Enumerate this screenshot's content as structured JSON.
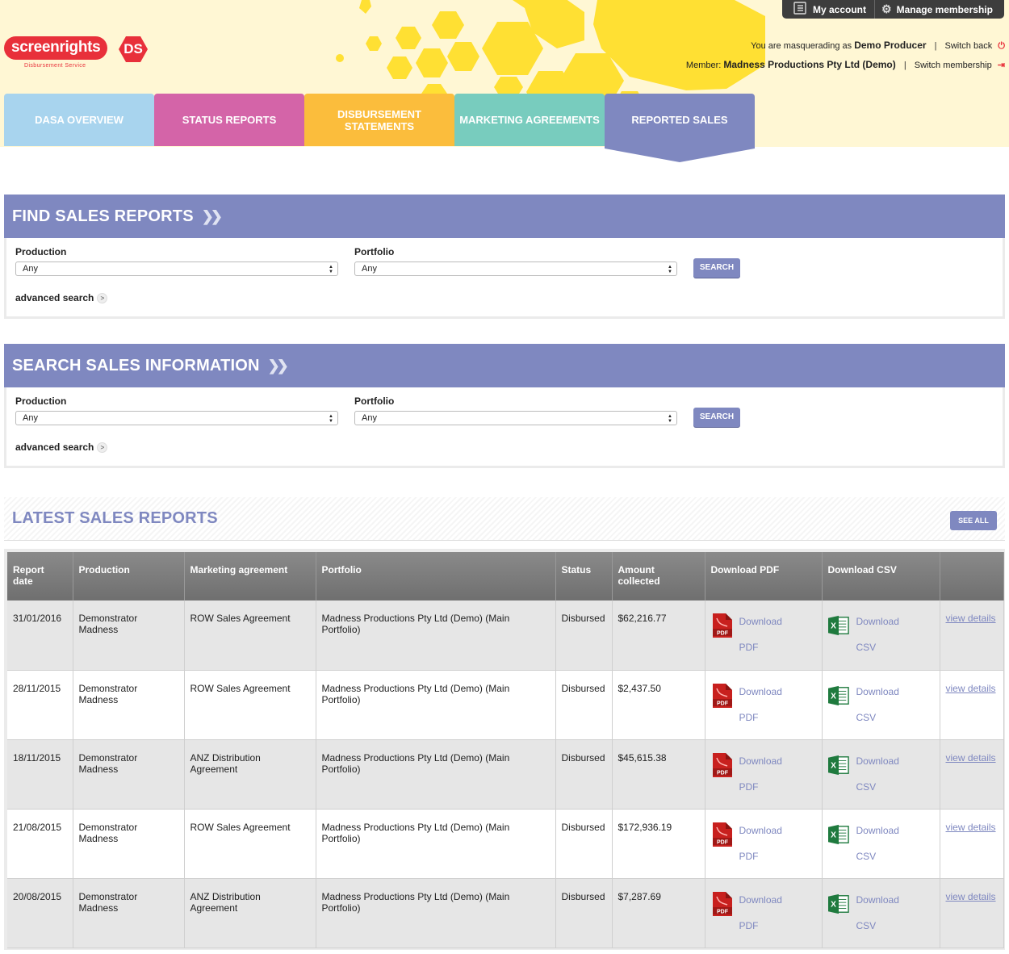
{
  "brand": {
    "name": "screenrights",
    "badge": "DS",
    "sub": "Disbursement Service",
    "red": "#e8303a"
  },
  "topbar": {
    "account_label": "My account",
    "account_icon": "account-icon",
    "membership_label": "Manage membership",
    "membership_icon": "gear-icon"
  },
  "masquerade": {
    "prefix": "You are masquerading as",
    "name": "Demo Producer",
    "switch_back": "Switch back"
  },
  "member": {
    "prefix": "Member:",
    "name": "Madness Productions Pty Ltd (Demo)",
    "switch": "Switch membership"
  },
  "tabs": [
    {
      "label": "DASA OVERVIEW",
      "color": "#a8d4ee"
    },
    {
      "label": "STATUS REPORTS",
      "color": "#d464a8"
    },
    {
      "label": "DISBURSEMENT STATEMENTS",
      "color": "#fbbd3c"
    },
    {
      "label": "MARKETING AGREEMENTS",
      "color": "#78ccbe"
    },
    {
      "label": "REPORTED SALES",
      "color": "#7f88c0",
      "active": true
    }
  ],
  "find": {
    "title": "FIND SALES REPORTS",
    "production_label": "Production",
    "production_value": "Any",
    "portfolio_label": "Portfolio",
    "portfolio_value": "Any",
    "search": "SEARCH",
    "advanced": "advanced search"
  },
  "searchinfo": {
    "title": "SEARCH SALES INFORMATION",
    "production_label": "Production",
    "production_value": "Any",
    "portfolio_label": "Portfolio",
    "portfolio_value": "Any",
    "search": "SEARCH",
    "advanced": "advanced search"
  },
  "latest": {
    "title": "LATEST SALES REPORTS",
    "see_all": "SEE ALL",
    "columns": [
      "Report date",
      "Production",
      "Marketing agreement",
      "Portfolio",
      "Status",
      "Amount collected",
      "Download PDF",
      "Download CSV",
      ""
    ],
    "download": "Download",
    "pdf": "PDF",
    "csv": "CSV",
    "view": "view details",
    "rows": [
      {
        "date": "31/01/2016",
        "production": "Demonstrator Madness",
        "agreement": "ROW Sales Agreement",
        "portfolio": "Madness Productions Pty Ltd (Demo) (Main Portfolio)",
        "status": "Disbursed",
        "amount": "$62,216.77"
      },
      {
        "date": "28/11/2015",
        "production": "Demonstrator Madness",
        "agreement": "ROW Sales Agreement",
        "portfolio": "Madness Productions Pty Ltd (Demo) (Main Portfolio)",
        "status": "Disbursed",
        "amount": "$2,437.50"
      },
      {
        "date": "18/11/2015",
        "production": "Demonstrator Madness",
        "agreement": "ANZ Distribution Agreement",
        "portfolio": "Madness Productions Pty Ltd (Demo) (Main Portfolio)",
        "status": "Disbursed",
        "amount": "$45,615.38"
      },
      {
        "date": "21/08/2015",
        "production": "Demonstrator Madness",
        "agreement": "ROW Sales Agreement",
        "portfolio": "Madness Productions Pty Ltd (Demo) (Main Portfolio)",
        "status": "Disbursed",
        "amount": "$172,936.19"
      },
      {
        "date": "20/08/2015",
        "production": "Demonstrator Madness",
        "agreement": "ANZ Distribution Agreement",
        "portfolio": "Madness Productions Pty Ltd (Demo) (Main Portfolio)",
        "status": "Disbursed",
        "amount": "$7,287.69"
      }
    ]
  },
  "colors": {
    "accent": "#7f88c0",
    "hex": "#ffdf33"
  }
}
